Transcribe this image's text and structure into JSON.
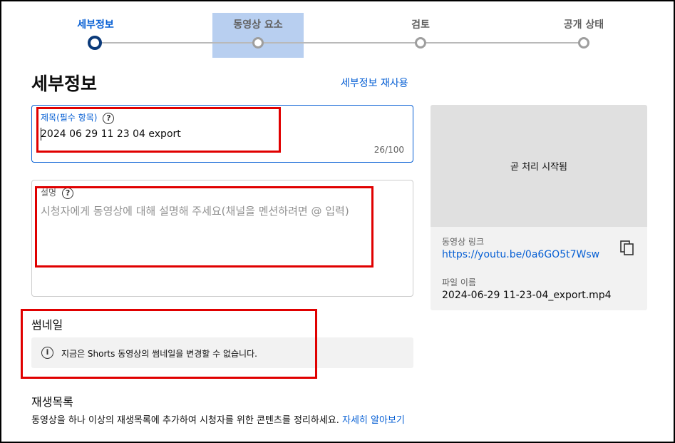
{
  "stepper": {
    "steps": [
      {
        "label": "세부정보"
      },
      {
        "label": "동영상 요소"
      },
      {
        "label": "검토"
      },
      {
        "label": "공개 상태"
      }
    ]
  },
  "page": {
    "heading": "세부정보",
    "reuse_link": "세부정보 재사용"
  },
  "title_field": {
    "label": "제목(필수 항목)",
    "help": "?",
    "value": "2024 06 29 11 23 04 export",
    "count": "26/100"
  },
  "description_field": {
    "label": "설명",
    "help": "?",
    "placeholder": "시청자에게 동영상에 대해 설명해 주세요(채널을 멘션하려면 @ 입력)"
  },
  "thumbnail": {
    "title": "썸네일",
    "info": "i",
    "notice": "지금은 Shorts 동영상의 썸네일을 변경할 수 없습니다."
  },
  "playlist": {
    "title": "재생목록",
    "description": "동영상을 하나 이상의 재생목록에 추가하여 시청자를 위한 콘텐츠를 정리하세요.",
    "learn_more": "자세히 알아보기"
  },
  "preview": {
    "processing": "곧 처리 시작됨",
    "link_label": "동영상 링크",
    "link_value": "https://youtu.be/0a6GO5t7Wsw",
    "filename_label": "파일 이름",
    "filename_value": "2024-06-29 11-23-04_export.mp4"
  },
  "colors": {
    "accent": "#065fd4",
    "annotation": "#e00000",
    "step_highlight": "#b8cff0"
  }
}
